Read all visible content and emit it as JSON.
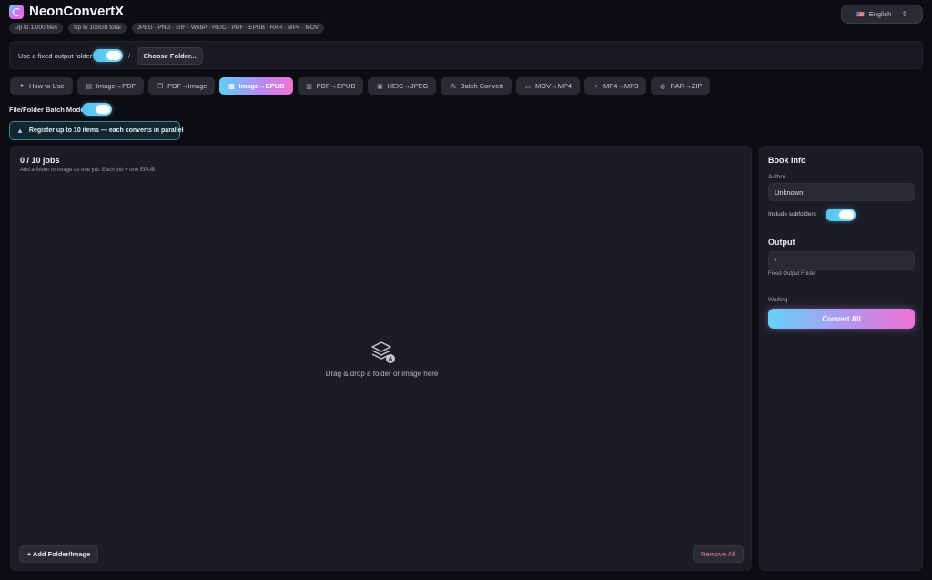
{
  "app": {
    "title": "NeonConvertX",
    "badges": [
      "Up to 1,000 files",
      "Up to 100GB total",
      "JPEG · PNG · GIF · WebP · HEIC · PDF · EPUB · RAR · MP4 · MOV"
    ],
    "language": {
      "flag": "🇺🇸",
      "label": "English"
    }
  },
  "output_bar": {
    "label": "Use a fixed output folder",
    "path": "/",
    "choose_label": "Choose Folder..."
  },
  "tabs": [
    {
      "label": "How to Use",
      "icon": "question-icon"
    },
    {
      "label": "Image→PDF",
      "icon": "document-icon"
    },
    {
      "label": "PDF→Image",
      "icon": "pages-icon"
    },
    {
      "label": "Image→EPUB",
      "icon": "book-icon",
      "active": true
    },
    {
      "label": "PDF→EPUB",
      "icon": "book-icon"
    },
    {
      "label": "HEIC→JPEG",
      "icon": "image-icon"
    },
    {
      "label": "Batch Convert",
      "icon": "grid-icon"
    },
    {
      "label": "MOV→MP4",
      "icon": "video-icon"
    },
    {
      "label": "MP4→MP3",
      "icon": "music-note-icon"
    },
    {
      "label": "RAR→ZIP",
      "icon": "archive-icon"
    }
  ],
  "batch": {
    "label": "File/Folder Batch Mode",
    "info": "Register up to 10 items — each converts in parallel"
  },
  "jobs": {
    "title": "0 / 10 jobs",
    "subtitle": "Add a folder or image as one job. Each job = one EPUB",
    "drop_text": "Drag & drop a folder or image here",
    "add_label": "+ Add Folder/Image",
    "remove_label": "Remove All"
  },
  "book_info": {
    "title": "Book Info",
    "author_label": "Author",
    "author_value": "Unknown",
    "subfolders_label": "Include subfolders",
    "output_title": "Output",
    "output_value": "/",
    "output_caption": "Fixed Output Folder",
    "status": "Waiting",
    "convert_label": "Convert All"
  },
  "colors": {
    "accent_cyan": "#5ad1f7",
    "accent_pink": "#f073d3",
    "danger": "#f07a8a"
  }
}
